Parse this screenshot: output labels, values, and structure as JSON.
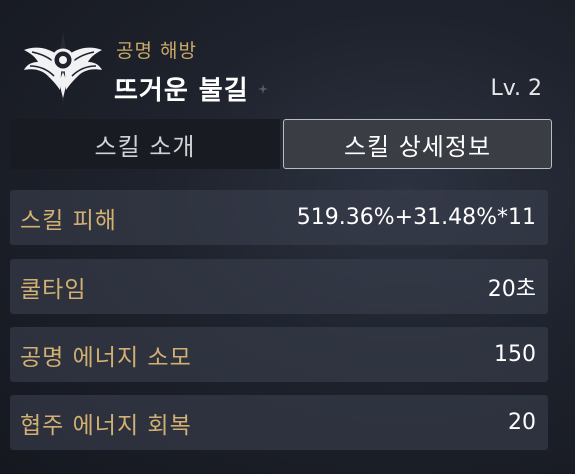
{
  "header": {
    "category": "공명 해방",
    "skill_name": "뜨거운 불길",
    "level": "Lv. 2",
    "emblem_icon": "winged-emblem-icon"
  },
  "tabs": [
    {
      "label": "스킬 소개",
      "active": false
    },
    {
      "label": "스킬 상세정보",
      "active": true
    }
  ],
  "stats": [
    {
      "label": "스킬 피해",
      "value": "519.36%+31.48%*11"
    },
    {
      "label": "쿨타임",
      "value": "20초"
    },
    {
      "label": "공명 에너지 소모",
      "value": "150"
    },
    {
      "label": "협주 에너지 회복",
      "value": "20"
    }
  ],
  "colors": {
    "label_gold": "#d2b072",
    "category_gold": "#c9a969",
    "row_bg": "#3a3f4e",
    "active_tab_bg": "#3a3d44",
    "background": "#1e222c"
  }
}
